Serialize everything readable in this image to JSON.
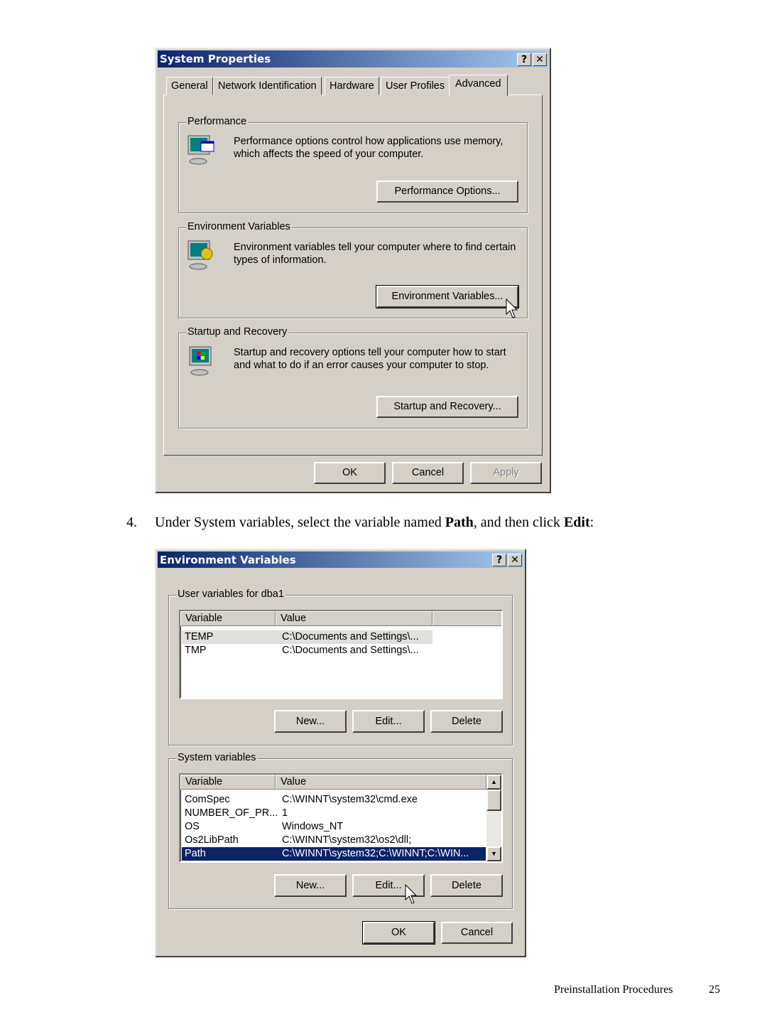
{
  "system_properties": {
    "title": "System Properties",
    "help_btn": "?",
    "close_btn": "✕",
    "tabs": [
      "General",
      "Network Identification",
      "Hardware",
      "User Profiles",
      "Advanced"
    ],
    "active_tab": "Advanced",
    "performance": {
      "label": "Performance",
      "description": "Performance options control how applications use memory, which affects the speed of your computer.",
      "button": "Performance Options..."
    },
    "environment": {
      "label": "Environment Variables",
      "description": "Environment variables tell your computer where to find certain types of information.",
      "button": "Environment Variables..."
    },
    "startup": {
      "label": "Startup and Recovery",
      "description": "Startup and recovery options tell your computer how to start and what to do if an error causes your computer to stop.",
      "button": "Startup and Recovery..."
    },
    "ok": "OK",
    "cancel": "Cancel",
    "apply": "Apply"
  },
  "step": {
    "number": "4.",
    "text_before": "Under System variables, select the variable named ",
    "bold1": "Path",
    "text_mid": ", and then click ",
    "bold2": "Edit",
    "text_after": ":"
  },
  "env_vars": {
    "title": "Environment Variables",
    "help_btn": "?",
    "close_btn": "✕",
    "user_group": "User variables for dba1",
    "columns": [
      "Variable",
      "Value"
    ],
    "user_rows": [
      {
        "variable": "TEMP",
        "value": "C:\\Documents and Settings\\..."
      },
      {
        "variable": "TMP",
        "value": "C:\\Documents and Settings\\..."
      }
    ],
    "system_group": "System variables",
    "system_rows": [
      {
        "variable": "ComSpec",
        "value": "C:\\WINNT\\system32\\cmd.exe"
      },
      {
        "variable": "NUMBER_OF_PR...",
        "value": "1"
      },
      {
        "variable": "OS",
        "value": "Windows_NT"
      },
      {
        "variable": "Os2LibPath",
        "value": "C:\\WINNT\\system32\\os2\\dll;"
      },
      {
        "variable": "Path",
        "value": "C:\\WINNT\\system32;C:\\WINNT;C:\\WIN..."
      }
    ],
    "selected_row": "Path",
    "new": "New...",
    "edit": "Edit...",
    "delete": "Delete",
    "ok": "OK",
    "cancel": "Cancel"
  },
  "footer": {
    "section": "Preinstallation Procedures",
    "page": "25"
  },
  "colors": {
    "titlebar_start": "#0a246a",
    "titlebar_end": "#a6caf0",
    "dialog_bg": "#d4d0c8",
    "selection": "#0a246a"
  }
}
